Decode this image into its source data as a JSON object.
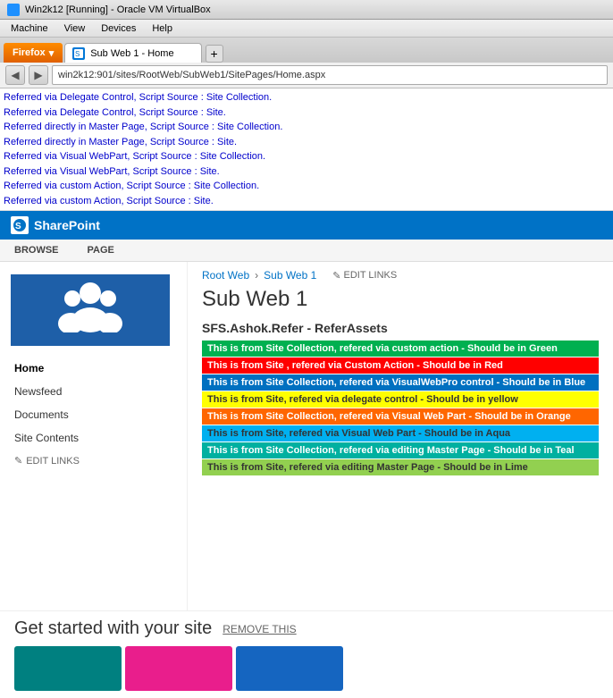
{
  "titlebar": {
    "text": "Win2k12 [Running] - Oracle VM VirtualBox"
  },
  "menubar": {
    "items": [
      "Machine",
      "View",
      "Devices",
      "Help"
    ]
  },
  "browser": {
    "firefox_label": "Firefox",
    "tab_label": "Sub Web 1 - Home",
    "new_tab_symbol": "+",
    "url": "win2k12:901/sites/RootWeb/SubWeb1/SitePages/Home.aspx",
    "back_symbol": "◀",
    "forward_symbol": "▶"
  },
  "infobar": {
    "lines": [
      "Referred via Delegate Control, Script Source : Site Collection.",
      "Referred via Delegate Control, Script Source : Site.",
      "Referred directly in Master Page, Script Source : Site Collection.",
      "Referred directly in Master Page, Script Source : Site.",
      "Referred via Visual WebPart, Script Source : Site Collection.",
      "Referred via Visual WebPart, Script Source : Site.",
      "Referred via custom Action, Script Source : Site Collection.",
      "Referred via custom Action, Script Source : Site."
    ]
  },
  "sharepoint": {
    "brand": "SharePoint"
  },
  "ribbon": {
    "tabs": [
      "BROWSE",
      "PAGE"
    ]
  },
  "breadcrumb": {
    "root": "Root Web",
    "current": "Sub Web 1",
    "edit_links": "EDIT LINKS"
  },
  "sidebar": {
    "nav_items": [
      "Home",
      "Newsfeed",
      "Documents",
      "Site Contents"
    ],
    "edit_links": "EDIT LINKS",
    "active_item": "Home"
  },
  "page": {
    "title": "Sub Web 1"
  },
  "refer_assets": {
    "title": "SFS.Ashok.Refer - ReferAssets",
    "items": [
      {
        "color": "green",
        "text": "This is from Site Collection, refered via custom action - Should be in Green"
      },
      {
        "color": "red",
        "text": "This is from Site , refered via Custom Action - Should be in Red"
      },
      {
        "color": "blue",
        "text": "This is from Site Collection, refered via VisualWebPro control - Should be in Blue"
      },
      {
        "color": "yellow",
        "text": "This is from Site, refered via delegate control - Should be in yellow"
      },
      {
        "color": "orange",
        "text": "This is from Site Collection, refered via Visual Web Part - Should be in Orange"
      },
      {
        "color": "aqua",
        "text": "This is from Site, refered via Visual Web Part - Should be in Aqua"
      },
      {
        "color": "teal",
        "text": "This is from Site Collection, refered via editing Master Page - Should be in Teal"
      },
      {
        "color": "lime",
        "text": "This is from Site, refered via editing Master Page - Should be in Lime"
      }
    ]
  },
  "get_started": {
    "title": "Get started with your site",
    "remove_btn": "REMOVE THIS",
    "cards": [
      {
        "color": "teal-card"
      },
      {
        "color": "pink-card"
      },
      {
        "color": "blue-card"
      }
    ]
  }
}
